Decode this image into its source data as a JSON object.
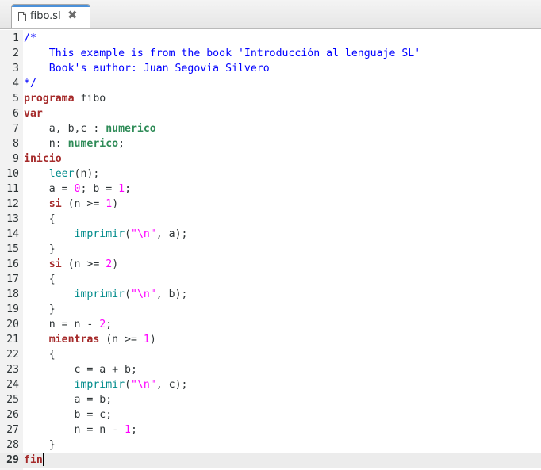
{
  "tab": {
    "title": "fibo.sl",
    "close_glyph": "✖",
    "file_icon": "document-icon",
    "accent_color": "#4a90d9"
  },
  "editor": {
    "current_line": 29,
    "colors": {
      "comment": "#0000ff",
      "keyword": "#a52a2a",
      "type": "#2e8b57",
      "number": "#ff00ff",
      "function": "#008b8b",
      "current_line_bg": "#ececec"
    },
    "lines": [
      {
        "n": "1",
        "tokens": [
          [
            "c",
            "/*"
          ]
        ]
      },
      {
        "n": "2",
        "tokens": [
          [
            "c",
            "    This example is from the book 'Introducción al lenguaje SL'"
          ]
        ]
      },
      {
        "n": "3",
        "tokens": [
          [
            "c",
            "    Book's author: Juan Segovia Silvero"
          ]
        ]
      },
      {
        "n": "4",
        "tokens": [
          [
            "c",
            "*/"
          ]
        ]
      },
      {
        "n": "5",
        "tokens": [
          [
            "k",
            "programa"
          ],
          [
            "p",
            " fibo"
          ]
        ]
      },
      {
        "n": "6",
        "tokens": [
          [
            "k",
            "var"
          ]
        ]
      },
      {
        "n": "7",
        "tokens": [
          [
            "p",
            "    a, b,c : "
          ],
          [
            "t",
            "numerico"
          ]
        ]
      },
      {
        "n": "8",
        "tokens": [
          [
            "p",
            "    n: "
          ],
          [
            "t",
            "numerico"
          ],
          [
            "p",
            ";"
          ]
        ]
      },
      {
        "n": "9",
        "tokens": [
          [
            "k",
            "inicio"
          ]
        ]
      },
      {
        "n": "10",
        "tokens": [
          [
            "p",
            "    "
          ],
          [
            "f",
            "leer"
          ],
          [
            "p",
            "(n);"
          ]
        ]
      },
      {
        "n": "11",
        "tokens": [
          [
            "p",
            "    a = "
          ],
          [
            "n",
            "0"
          ],
          [
            "p",
            "; b = "
          ],
          [
            "n",
            "1"
          ],
          [
            "p",
            ";"
          ]
        ]
      },
      {
        "n": "12",
        "tokens": [
          [
            "p",
            "    "
          ],
          [
            "k",
            "si"
          ],
          [
            "p",
            " (n >= "
          ],
          [
            "n",
            "1"
          ],
          [
            "p",
            ")"
          ]
        ]
      },
      {
        "n": "13",
        "tokens": [
          [
            "p",
            "    {"
          ]
        ]
      },
      {
        "n": "14",
        "tokens": [
          [
            "p",
            "        "
          ],
          [
            "f",
            "imprimir"
          ],
          [
            "p",
            "("
          ],
          [
            "s",
            "\"\\n\""
          ],
          [
            "p",
            ", a);"
          ]
        ]
      },
      {
        "n": "15",
        "tokens": [
          [
            "p",
            "    }"
          ]
        ]
      },
      {
        "n": "16",
        "tokens": [
          [
            "p",
            "    "
          ],
          [
            "k",
            "si"
          ],
          [
            "p",
            " (n >= "
          ],
          [
            "n",
            "2"
          ],
          [
            "p",
            ")"
          ]
        ]
      },
      {
        "n": "17",
        "tokens": [
          [
            "p",
            "    {"
          ]
        ]
      },
      {
        "n": "18",
        "tokens": [
          [
            "p",
            "        "
          ],
          [
            "f",
            "imprimir"
          ],
          [
            "p",
            "("
          ],
          [
            "s",
            "\"\\n\""
          ],
          [
            "p",
            ", b);"
          ]
        ]
      },
      {
        "n": "19",
        "tokens": [
          [
            "p",
            "    }"
          ]
        ]
      },
      {
        "n": "20",
        "tokens": [
          [
            "p",
            "    n = n - "
          ],
          [
            "n",
            "2"
          ],
          [
            "p",
            ";"
          ]
        ]
      },
      {
        "n": "21",
        "tokens": [
          [
            "p",
            "    "
          ],
          [
            "k",
            "mientras"
          ],
          [
            "p",
            " (n >= "
          ],
          [
            "n",
            "1"
          ],
          [
            "p",
            ")"
          ]
        ]
      },
      {
        "n": "22",
        "tokens": [
          [
            "p",
            "    {"
          ]
        ]
      },
      {
        "n": "23",
        "tokens": [
          [
            "p",
            "        c = a + b;"
          ]
        ]
      },
      {
        "n": "24",
        "tokens": [
          [
            "p",
            "        "
          ],
          [
            "f",
            "imprimir"
          ],
          [
            "p",
            "("
          ],
          [
            "s",
            "\"\\n\""
          ],
          [
            "p",
            ", c);"
          ]
        ]
      },
      {
        "n": "25",
        "tokens": [
          [
            "p",
            "        a = b;"
          ]
        ]
      },
      {
        "n": "26",
        "tokens": [
          [
            "p",
            "        b = c;"
          ]
        ]
      },
      {
        "n": "27",
        "tokens": [
          [
            "p",
            "        n = n - "
          ],
          [
            "n",
            "1"
          ],
          [
            "p",
            ";"
          ]
        ]
      },
      {
        "n": "28",
        "tokens": [
          [
            "p",
            "    }"
          ]
        ]
      },
      {
        "n": "29",
        "tokens": [
          [
            "k",
            "fin"
          ]
        ]
      }
    ]
  }
}
